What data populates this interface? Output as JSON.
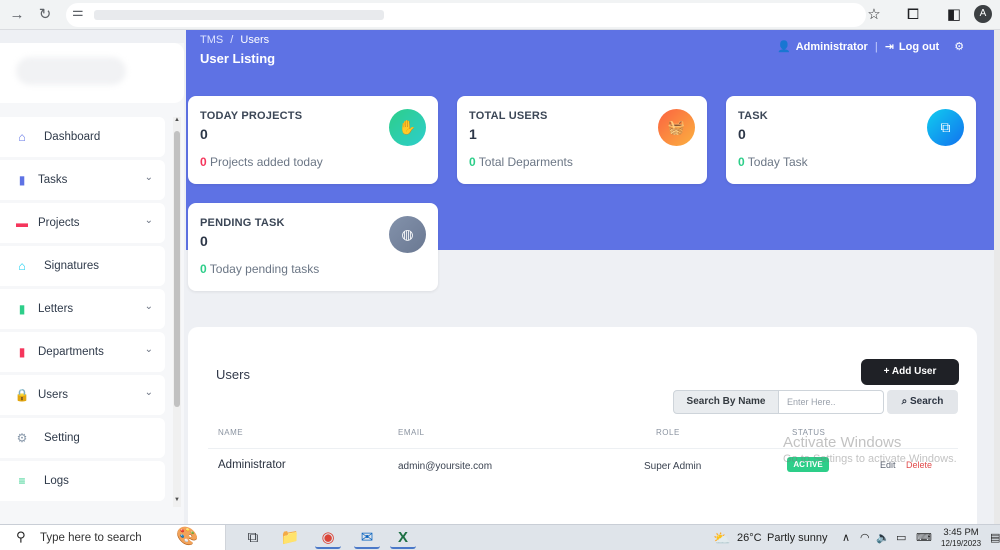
{
  "browser": {
    "icons": {
      "back": "arrow-right-icon",
      "reload": "reload-icon",
      "site_info": "tune-icon",
      "bookmark": "star-icon",
      "extensions": "puzzle-icon",
      "side_panel": "side-panel-icon"
    },
    "profile_initial": "A"
  },
  "header": {
    "breadcrumb_root": "TMS",
    "breadcrumb_sep": "/",
    "breadcrumb_current": "Users",
    "title": "User Listing",
    "user_name": "Administrator",
    "separator": "|",
    "logout_label": "Log out"
  },
  "sidebar": {
    "items": [
      {
        "label": "Dashboard",
        "icon": "home-icon",
        "glyph": "⌂",
        "color": "#5e72e4",
        "has_chevron": false
      },
      {
        "label": "Tasks",
        "icon": "file-icon",
        "glyph": "▮",
        "color": "#5e72e4",
        "has_chevron": true
      },
      {
        "label": "Projects",
        "icon": "briefcase-icon",
        "glyph": "▬",
        "color": "#f5365c",
        "has_chevron": true
      },
      {
        "label": "Signatures",
        "icon": "home-icon",
        "glyph": "⌂",
        "color": "#11cdef",
        "has_chevron": false
      },
      {
        "label": "Letters",
        "icon": "file-icon",
        "glyph": "▮",
        "color": "#2dce89",
        "has_chevron": true
      },
      {
        "label": "Departments",
        "icon": "building-icon",
        "glyph": "▮",
        "color": "#f5365c",
        "has_chevron": true
      },
      {
        "label": "Users",
        "icon": "lock-icon",
        "glyph": "🔒",
        "color": "#5e72e4",
        "has_chevron": true
      },
      {
        "label": "Setting",
        "icon": "gear-icon",
        "glyph": "⚙",
        "color": "#8898aa",
        "has_chevron": false
      },
      {
        "label": "Logs",
        "icon": "database-icon",
        "glyph": "≡",
        "color": "#2dce89",
        "has_chevron": false
      }
    ]
  },
  "cards": [
    {
      "label": "TODAY PROJECTS",
      "value": "0",
      "foot_num": "0",
      "foot_text": " Projects added today",
      "num_color": "#f5365c",
      "icon": "hand-holding-icon",
      "glyph": "✋",
      "bg": "linear-gradient(135deg,#2dce89,#2dcecc)"
    },
    {
      "label": "TOTAL USERS",
      "value": "1",
      "foot_num": "0",
      "foot_text": " Total Deparments",
      "num_color": "#2dce89",
      "icon": "basket-icon",
      "glyph": "🧺",
      "bg": "linear-gradient(135deg,#fb6340,#fbb140)"
    },
    {
      "label": "TASK",
      "value": "0",
      "foot_num": "0",
      "foot_text": " Today Task",
      "num_color": "#2dce89",
      "icon": "copy-icon",
      "glyph": "⧉",
      "bg": "linear-gradient(135deg,#11cdef,#1171ef)"
    },
    {
      "label": "PENDING TASK",
      "value": "0",
      "foot_num": "0",
      "foot_text": " Today pending tasks",
      "num_color": "#2dce89",
      "icon": "globe-icon",
      "glyph": "◍",
      "bg": "linear-gradient(135deg,#8392ab,#6a7892)"
    }
  ],
  "users_panel": {
    "title": "Users",
    "add_button": "+ Add User",
    "search_label": "Search By Name",
    "search_placeholder": "Enter Here..",
    "search_button": "Search",
    "columns": [
      "NAME",
      "EMAIL",
      "ROLE",
      "STATUS"
    ],
    "rows": [
      {
        "name": "Administrator",
        "email": "admin@yoursite.com",
        "role": "Super Admin",
        "status": "ACTIVE",
        "edit": "Edit",
        "delete": "Delete"
      }
    ]
  },
  "watermark": {
    "line1": "Activate Windows",
    "line2": "Go to Settings to activate Windows."
  },
  "taskbar": {
    "search_text": "Type here to search",
    "apps": [
      {
        "name": "task-view-icon",
        "glyph": "⧉"
      },
      {
        "name": "file-explorer-icon",
        "glyph": "📁"
      },
      {
        "name": "chrome-icon",
        "glyph": "◉"
      },
      {
        "name": "outlook-icon",
        "glyph": "✉"
      },
      {
        "name": "excel-icon",
        "glyph": "X"
      }
    ],
    "weather_temp": "26°C",
    "weather_text": "Partly sunny",
    "time": "3:45 PM",
    "date": "12/19/2023"
  }
}
